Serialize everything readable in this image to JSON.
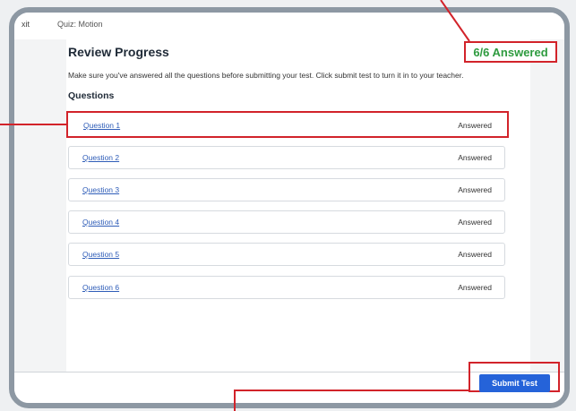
{
  "header": {
    "exit_label": "xit",
    "quiz_title": "Quiz: Motion"
  },
  "review": {
    "title": "Review Progress",
    "answered_count": "6/6 Answered",
    "instructions": "Make sure you've answered all the questions before submitting your test. Click submit test to turn it in to your teacher.",
    "questions_label": "Questions",
    "questions": [
      {
        "label": "Question 1",
        "status": "Answered"
      },
      {
        "label": "Question 2",
        "status": "Answered"
      },
      {
        "label": "Question 3",
        "status": "Answered"
      },
      {
        "label": "Question 4",
        "status": "Answered"
      },
      {
        "label": "Question 5",
        "status": "Answered"
      },
      {
        "label": "Question 6",
        "status": "Answered"
      }
    ]
  },
  "footer": {
    "submit_label": "Submit Test"
  },
  "colors": {
    "annotation": "#d2232a",
    "answered_green": "#2e9b3f",
    "link_blue": "#2f5db8",
    "button_blue": "#2563d9",
    "frame": "#8d98a3"
  }
}
